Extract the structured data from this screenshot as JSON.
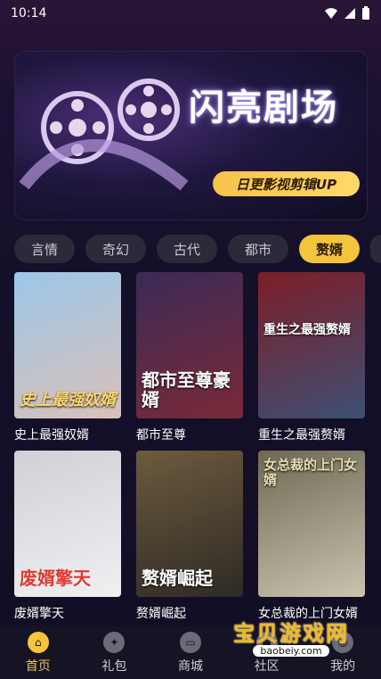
{
  "status_bar": {
    "time": "10:14"
  },
  "banner": {
    "title": "闪亮剧场",
    "subtitle": "日更影视剪辑UP"
  },
  "categories": [
    {
      "label": "言情"
    },
    {
      "label": "奇幻"
    },
    {
      "label": "古代"
    },
    {
      "label": "都市"
    },
    {
      "label": "赘婿",
      "active": true
    }
  ],
  "dramas": [
    {
      "title": "史上最强奴婿",
      "cover_text": "史上最强奴婿",
      "colors": [
        "#9cc6e8",
        "#d9c1b8"
      ]
    },
    {
      "title": "都市至尊",
      "cover_text": "都市至尊豪婿",
      "colors": [
        "#3b2a56",
        "#7a2a38"
      ]
    },
    {
      "title": "重生之最强赘婿",
      "cover_text": "重生之最强赘婿",
      "colors": [
        "#7c1e28",
        "#3e4f73"
      ]
    },
    {
      "title": "废婿擎天",
      "cover_text": "废婿擎天",
      "colors": [
        "#cfd1d8",
        "#f0f0f2"
      ]
    },
    {
      "title": "赘婿崛起",
      "cover_text": "赘婿崛起",
      "colors": [
        "#6c5b3d",
        "#2e2a25"
      ]
    },
    {
      "title": "女总裁的上门女婿",
      "cover_text": "女总裁的上门女婿",
      "colors": [
        "#6d6952",
        "#c9c4ad"
      ]
    }
  ],
  "nav": [
    {
      "label": "首页",
      "icon": "home-icon",
      "active": true
    },
    {
      "label": "礼包",
      "icon": "gift-icon"
    },
    {
      "label": "商城",
      "icon": "shop-icon"
    },
    {
      "label": "社区",
      "icon": "community-icon"
    },
    {
      "label": "我的",
      "icon": "profile-icon"
    }
  ],
  "watermark": {
    "main": "宝贝游戏网",
    "sub": "baobeiy.com"
  },
  "colors": {
    "accent": "#f4c53c",
    "background": "#15102a"
  }
}
